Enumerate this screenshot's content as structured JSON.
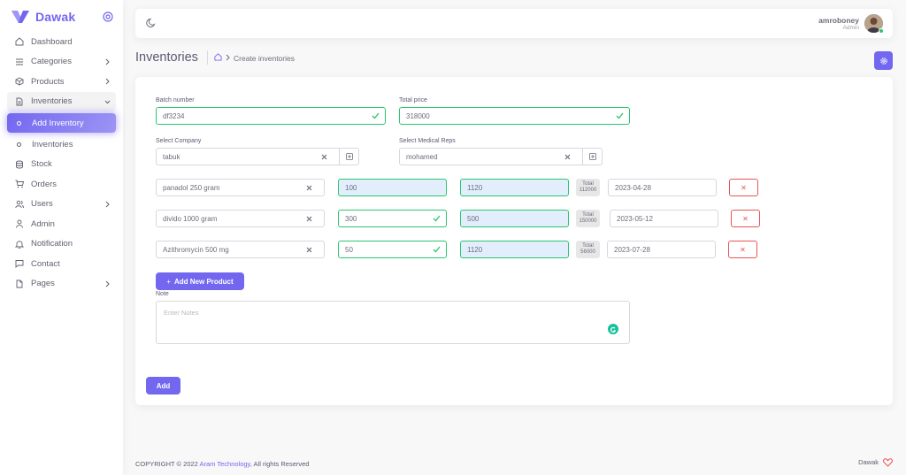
{
  "app": {
    "brand": "Dawak"
  },
  "colors": {
    "primary": "#7367f0",
    "success": "#28c76f",
    "danger": "#ea5455"
  },
  "sidebar": {
    "items": [
      {
        "label": "Dashboard",
        "icon": "home-icon"
      },
      {
        "label": "Categories",
        "icon": "list-icon",
        "chevron": true
      },
      {
        "label": "Products",
        "icon": "box-icon",
        "chevron": true
      },
      {
        "label": "Inventories",
        "icon": "file-icon",
        "chevron": true,
        "open": true
      },
      {
        "label": "Add Inventory",
        "icon": "circle-icon",
        "active": true
      },
      {
        "label": "Inventories",
        "icon": "circle-icon"
      },
      {
        "label": "Stock",
        "icon": "database-icon"
      },
      {
        "label": "Orders",
        "icon": "cart-icon"
      },
      {
        "label": "Users",
        "icon": "users-icon",
        "chevron": true
      },
      {
        "label": "Admin",
        "icon": "user-icon"
      },
      {
        "label": "Notification",
        "icon": "bell-icon"
      },
      {
        "label": "Contact",
        "icon": "message-icon"
      },
      {
        "label": "Pages",
        "icon": "page-icon",
        "chevron": true
      }
    ]
  },
  "navbar": {
    "user_name": "amroboney",
    "user_role": "Admin"
  },
  "header": {
    "title": "Inventories",
    "breadcrumb_current": "Create inventories"
  },
  "form": {
    "batch_label": "Batch number",
    "batch_value": "df3234",
    "total_price_label": "Total price",
    "total_price_value": "318000",
    "company_label": "Select Company",
    "company_value": "tabuk",
    "reps_label": "Select Medical Reps",
    "reps_value": "mohamed",
    "rows": [
      {
        "product": "panadol 250 gram",
        "qty": "100",
        "price": "1120",
        "total_label": "Total",
        "total_value": "112000",
        "date": "2023-04-28"
      },
      {
        "product": "divido 1000 gram",
        "qty": "300",
        "price": "500",
        "total_label": "Total",
        "total_value": "150000",
        "date": "2023-05-12"
      },
      {
        "product": "Azithromycin 500 mg",
        "qty": "50",
        "price": "1120",
        "total_label": "Total",
        "total_value": "56000",
        "date": "2023-07-28"
      }
    ],
    "add_product_label": "Add New Product",
    "note_label": "Note",
    "note_placeholder": "Enter Notes",
    "submit_label": "Add"
  },
  "footer": {
    "copyright": "COPYRIGHT © 2022 ",
    "company": "Aram Technology",
    "rights": ", All rights Reserved",
    "right_text": "Dawak"
  }
}
